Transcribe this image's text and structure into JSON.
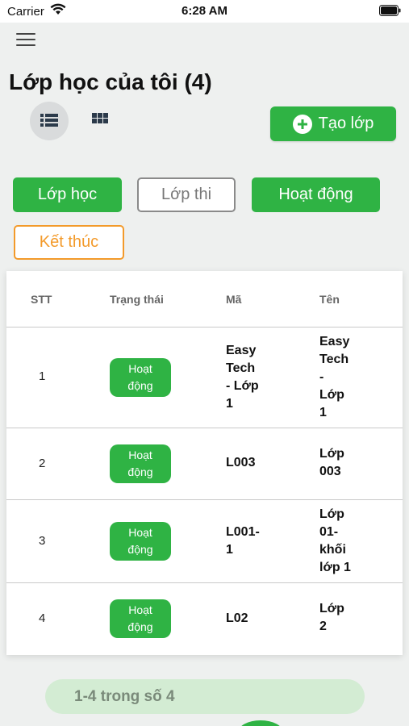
{
  "status_bar": {
    "carrier": "Carrier",
    "time": "6:28 AM"
  },
  "header": {
    "title": "Lớp học của tôi (4)"
  },
  "toolbar": {
    "create_label": "Tạo lớp"
  },
  "filters": [
    {
      "label": "Lớp học",
      "style": "solid"
    },
    {
      "label": "Lớp thi",
      "style": "outline-gray"
    },
    {
      "label": "Hoạt động",
      "style": "solid"
    },
    {
      "label": "Kết thúc",
      "style": "outline-orange"
    }
  ],
  "table": {
    "headers": [
      "STT",
      "Trạng thái",
      "Mã",
      "Tên"
    ],
    "rows": [
      {
        "stt": "1",
        "status": "Hoạt\nđộng",
        "code": "Easy\nTech\n- Lớp\n1",
        "name": "Easy\nTech\n-\nLớp\n1"
      },
      {
        "stt": "2",
        "status": "Hoạt\nđộng",
        "code": "L003",
        "name": "Lớp\n003"
      },
      {
        "stt": "3",
        "status": "Hoạt\nđộng",
        "code": "L001-\n1",
        "name": "Lớp\n01-\nkhối\nlớp 1"
      },
      {
        "stt": "4",
        "status": "Hoạt\nđộng",
        "code": "L02",
        "name": "Lớp\n2"
      }
    ]
  },
  "pagination": {
    "range_text": "1-4 trong số 4"
  },
  "colors": {
    "accent": "#2fb344",
    "warning": "#f39a2a"
  }
}
